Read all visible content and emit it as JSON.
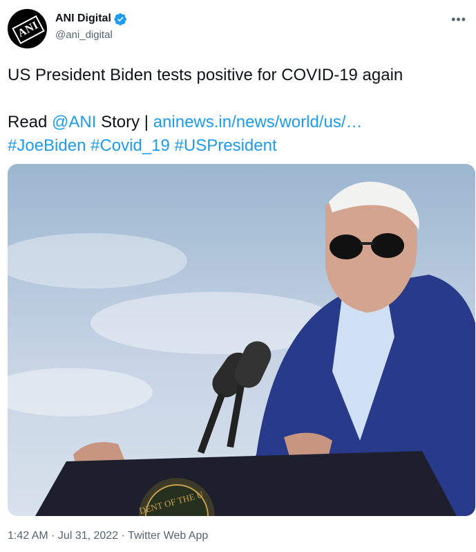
{
  "author": {
    "display_name": "ANI Digital",
    "handle": "@ani_digital",
    "avatar_text": "ANI",
    "verified": true
  },
  "tweet": {
    "headline": "US President Biden tests positive for COVID-19 again",
    "read_prefix": "Read ",
    "mention": "@ANI",
    "story_text": " Story | ",
    "link_text": "aninews.in/news/world/us/…",
    "hashtags": [
      "#JoeBiden",
      "#Covid_19",
      "#USPresident"
    ],
    "media_seal_text": "DENT OF THE U"
  },
  "meta": {
    "time": "1:42 AM",
    "separator": " · ",
    "date": "Jul 31, 2022",
    "source": "Twitter Web App"
  },
  "colors": {
    "link": "#1d9bf0",
    "verified_badge": "#1d9bf0",
    "secondary_text": "#536471"
  },
  "icons": {
    "more": "more-icon",
    "verified": "verified-badge-icon"
  }
}
